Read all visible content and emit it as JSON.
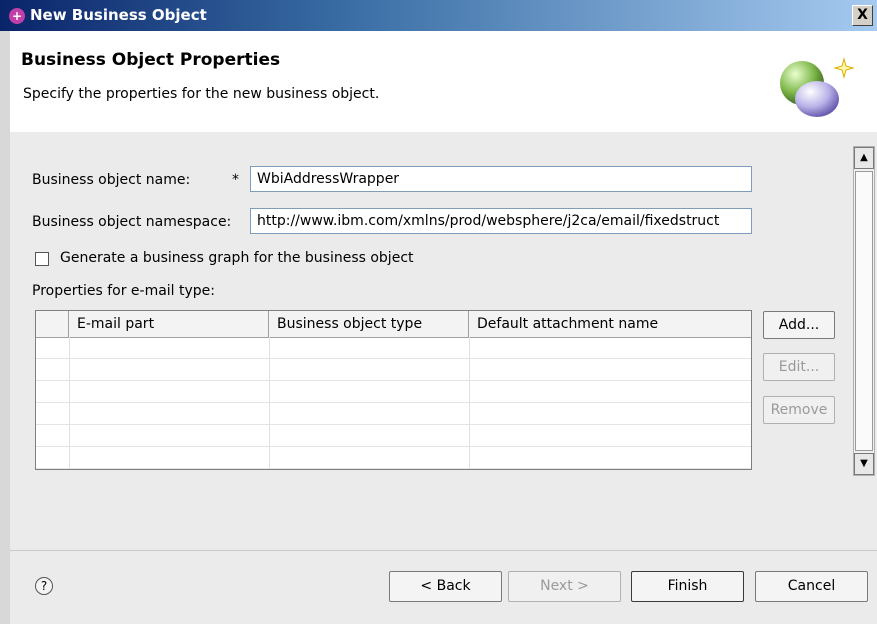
{
  "window": {
    "title": "New Business Object",
    "close_label": "X"
  },
  "header": {
    "title": "Business Object Properties",
    "description": "Specify the properties for the new business object."
  },
  "form": {
    "name_label": "Business object name:",
    "required_marker": "*",
    "name_value": "WbiAddressWrapper",
    "namespace_label": "Business object namespace:",
    "namespace_value": "http://www.ibm.com/xmlns/prod/websphere/j2ca/email/fixedstruct",
    "graph_checkbox_label": "Generate a business graph for the business object",
    "graph_checked": false,
    "properties_label": "Properties for e-mail type:"
  },
  "table": {
    "columns": [
      "E-mail part",
      "Business object type",
      "Default attachment name"
    ],
    "rows": []
  },
  "side_buttons": {
    "add": "Add...",
    "edit": "Edit...",
    "remove": "Remove"
  },
  "footer": {
    "help_icon": "?",
    "back": "< Back",
    "next": "Next >",
    "finish": "Finish",
    "cancel": "Cancel"
  },
  "icons": {
    "window_icon": "wizard-app-icon",
    "header_icon": "business-object-spheres-icon",
    "help": "help-icon"
  }
}
